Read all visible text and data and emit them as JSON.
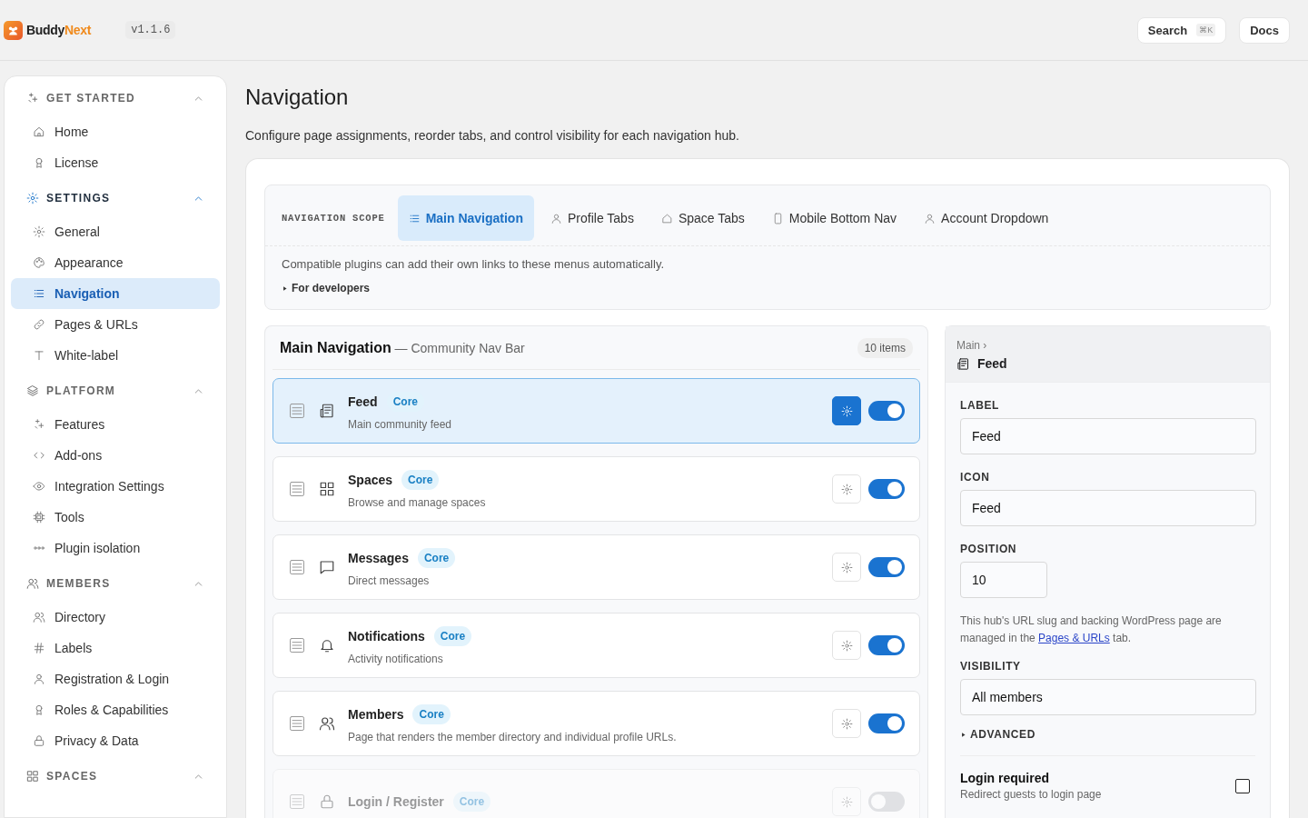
{
  "header": {
    "brand": {
      "first": "Buddy",
      "second": "Next"
    },
    "version": "v1.1.6",
    "search": {
      "label": "Search",
      "shortcut": "⌘K"
    },
    "docs": "Docs"
  },
  "sidebar": {
    "sections": [
      {
        "title": "GET STARTED",
        "active": false,
        "expanded": true,
        "items": [
          {
            "label": "Home",
            "selected": false
          },
          {
            "label": "License",
            "selected": false
          }
        ]
      },
      {
        "title": "SETTINGS",
        "active": true,
        "expanded": true,
        "items": [
          {
            "label": "General",
            "selected": false
          },
          {
            "label": "Appearance",
            "selected": false
          },
          {
            "label": "Navigation",
            "selected": true
          },
          {
            "label": "Pages & URLs",
            "selected": false
          },
          {
            "label": "White-label",
            "selected": false
          }
        ]
      },
      {
        "title": "PLATFORM",
        "active": false,
        "expanded": true,
        "items": [
          {
            "label": "Features",
            "selected": false
          },
          {
            "label": "Add-ons",
            "selected": false
          },
          {
            "label": "Integration Settings",
            "selected": false
          },
          {
            "label": "Tools",
            "selected": false
          },
          {
            "label": "Plugin isolation",
            "selected": false
          }
        ]
      },
      {
        "title": "MEMBERS",
        "active": false,
        "expanded": true,
        "items": [
          {
            "label": "Directory",
            "selected": false
          },
          {
            "label": "Labels",
            "selected": false
          },
          {
            "label": "Registration & Login",
            "selected": false
          },
          {
            "label": "Roles & Capabilities",
            "selected": false
          },
          {
            "label": "Privacy & Data",
            "selected": false
          }
        ]
      },
      {
        "title": "SPACES",
        "active": false,
        "expanded": true
      }
    ]
  },
  "page": {
    "title": "Navigation",
    "description": "Configure page assignments, reorder tabs, and control visibility for each navigation hub."
  },
  "scope": {
    "label": "NAVIGATION SCOPE",
    "tabs": [
      {
        "label": "Main Navigation",
        "selected": true
      },
      {
        "label": "Profile Tabs",
        "selected": false
      },
      {
        "label": "Space Tabs",
        "selected": false
      },
      {
        "label": "Mobile Bottom Nav",
        "selected": false
      },
      {
        "label": "Account Dropdown",
        "selected": false
      }
    ],
    "hint": "Compatible plugins can add their own links to these menus automatically.",
    "developers": {
      "label": "For developers",
      "expanded": false
    }
  },
  "menu": {
    "title": "Main Navigation",
    "subtitle": "— Community Nav Bar",
    "count": "10 items",
    "rows": [
      {
        "title": "Feed",
        "badge": "Core",
        "description": "Main community feed",
        "enabled": true,
        "selected": true,
        "disabled": false
      },
      {
        "title": "Spaces",
        "badge": "Core",
        "description": "Browse and manage spaces",
        "enabled": true,
        "selected": false,
        "disabled": false
      },
      {
        "title": "Messages",
        "badge": "Core",
        "description": "Direct messages",
        "enabled": true,
        "selected": false,
        "disabled": false
      },
      {
        "title": "Notifications",
        "badge": "Core",
        "description": "Activity notifications",
        "enabled": true,
        "selected": false,
        "disabled": false
      },
      {
        "title": "Members",
        "badge": "Core",
        "description": "Page that renders the member directory and individual profile URLs.",
        "enabled": true,
        "selected": false,
        "disabled": false
      },
      {
        "title": "Login / Register",
        "badge": "Core",
        "enabled": false,
        "selected": false,
        "disabled": true
      }
    ]
  },
  "editor": {
    "breadcrumb": "Main ›",
    "title": "Feed",
    "fields": [
      {
        "label": "LABEL",
        "value": "Feed",
        "kind": "wide"
      },
      {
        "label": "ICON",
        "value": "Feed",
        "kind": "wide"
      },
      {
        "label": "POSITION",
        "value": "10",
        "kind": "short"
      }
    ],
    "note": {
      "before": "This hub's URL slug and backing WordPress page are managed in the",
      "link": "Pages & URLs",
      "after": "tab."
    },
    "visibility": {
      "label": "VISIBILITY",
      "value": "All members"
    },
    "advanced": {
      "label": "ADVANCED",
      "expanded": false
    },
    "login_required": {
      "title": "Login required",
      "description": "Redirect guests to login page",
      "checked": false
    }
  }
}
